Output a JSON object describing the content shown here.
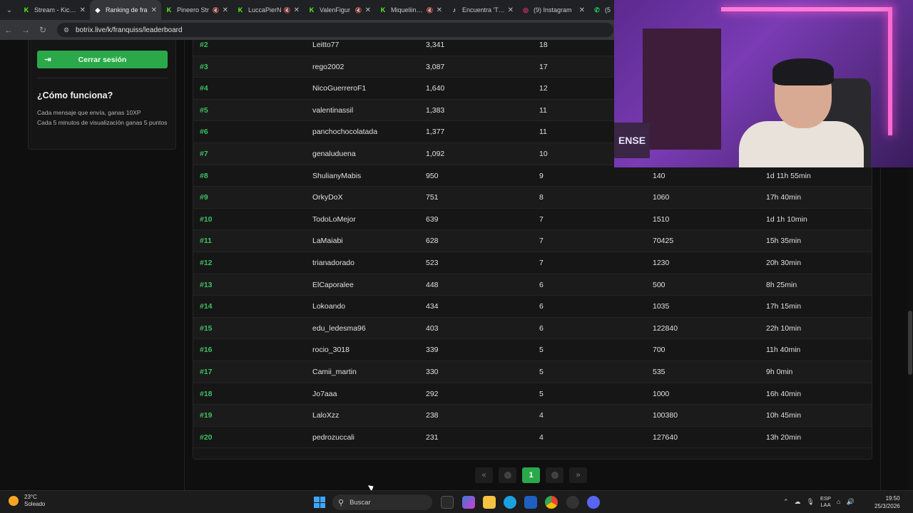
{
  "browser": {
    "tabs": [
      {
        "title": "Stream - Kick D",
        "favicon": "kick-icon",
        "color": "#53fc18"
      },
      {
        "title": "Ranking de fra",
        "favicon": "botrix-icon",
        "color": "#ffffff",
        "active": true
      },
      {
        "title": "Pineero Str",
        "favicon": "kick-icon",
        "color": "#53fc18"
      },
      {
        "title": "LuccaPierN",
        "favicon": "kick-icon",
        "color": "#53fc18"
      },
      {
        "title": "ValenFigur",
        "favicon": "kick-icon",
        "color": "#53fc18"
      },
      {
        "title": "Miqueliin Strea",
        "favicon": "kick-icon",
        "color": "#53fc18"
      },
      {
        "title": "Encuentra 'TOI",
        "favicon": "tiktok-icon",
        "color": "#ffffff"
      },
      {
        "title": "(9) Instagram",
        "favicon": "instagram-icon",
        "color": "#e1306c"
      },
      {
        "title": "(5",
        "favicon": "whatsapp-icon",
        "color": "#25d366"
      }
    ],
    "url": "botrix.live/k/franquiss/leaderboard"
  },
  "sidebar": {
    "logout_label": "Cerrar sesión",
    "how_title": "¿Cómo funciona?",
    "how_lines": [
      "Cada mensaje que envía, ganas 10XP",
      "Cada 5 minutos de visualización ganas 5 puntos"
    ]
  },
  "leaderboard": {
    "rows": [
      {
        "rank": "#2",
        "user": "Leitto77",
        "xp": "3,341",
        "level": "18",
        "points": "",
        "time": ""
      },
      {
        "rank": "#3",
        "user": "rego2002",
        "xp": "3,087",
        "level": "17",
        "points": "",
        "time": ""
      },
      {
        "rank": "#4",
        "user": "NicoGuerreroF1",
        "xp": "1,640",
        "level": "12",
        "points": "",
        "time": ""
      },
      {
        "rank": "#5",
        "user": "valentinassil",
        "xp": "1,383",
        "level": "11",
        "points": "",
        "time": ""
      },
      {
        "rank": "#6",
        "user": "panchochocolatada",
        "xp": "1,377",
        "level": "11",
        "points": "",
        "time": ""
      },
      {
        "rank": "#7",
        "user": "genaluduena",
        "xp": "1,092",
        "level": "10",
        "points": "",
        "time": ""
      },
      {
        "rank": "#8",
        "user": "ShulianyMabis",
        "xp": "950",
        "level": "9",
        "points": "140",
        "time": "1d 11h 55min"
      },
      {
        "rank": "#9",
        "user": "OrkyDoX",
        "xp": "751",
        "level": "8",
        "points": "1060",
        "time": "17h 40min"
      },
      {
        "rank": "#10",
        "user": "TodoLoMejor",
        "xp": "639",
        "level": "7",
        "points": "1510",
        "time": "1d 1h 10min"
      },
      {
        "rank": "#11",
        "user": "LaMaiabi",
        "xp": "628",
        "level": "7",
        "points": "70425",
        "time": "15h 35min"
      },
      {
        "rank": "#12",
        "user": "trianadorado",
        "xp": "523",
        "level": "7",
        "points": "1230",
        "time": "20h 30min"
      },
      {
        "rank": "#13",
        "user": "ElCaporalee",
        "xp": "448",
        "level": "6",
        "points": "500",
        "time": "8h 25min"
      },
      {
        "rank": "#14",
        "user": "Lokoando",
        "xp": "434",
        "level": "6",
        "points": "1035",
        "time": "17h 15min"
      },
      {
        "rank": "#15",
        "user": "edu_ledesma96",
        "xp": "403",
        "level": "6",
        "points": "122840",
        "time": "22h 10min"
      },
      {
        "rank": "#16",
        "user": "rocio_3018",
        "xp": "339",
        "level": "5",
        "points": "700",
        "time": "11h 40min"
      },
      {
        "rank": "#17",
        "user": "Camii_martin",
        "xp": "330",
        "level": "5",
        "points": "535",
        "time": "9h 0min"
      },
      {
        "rank": "#18",
        "user": "Jo7aaa",
        "xp": "292",
        "level": "5",
        "points": "1000",
        "time": "16h 40min"
      },
      {
        "rank": "#19",
        "user": "LaloXzz",
        "xp": "238",
        "level": "4",
        "points": "100380",
        "time": "10h 45min"
      },
      {
        "rank": "#20",
        "user": "pedrozuccali",
        "xp": "231",
        "level": "4",
        "points": "127640",
        "time": "13h 20min"
      }
    ]
  },
  "pagination": {
    "first": "«",
    "prev": "‹",
    "current": "1",
    "next": "›",
    "last": "»"
  },
  "webcam": {
    "sign_text": "ENSE"
  },
  "taskbar": {
    "weather_temp": "23°C",
    "weather_desc": "Soleado",
    "search_placeholder": "Buscar",
    "lang_1": "ESP",
    "lang_2": "LAA",
    "time": "19:50",
    "date": "25/3/2026"
  },
  "colors": {
    "accent": "#2aa84a",
    "rank": "#3ec062"
  }
}
